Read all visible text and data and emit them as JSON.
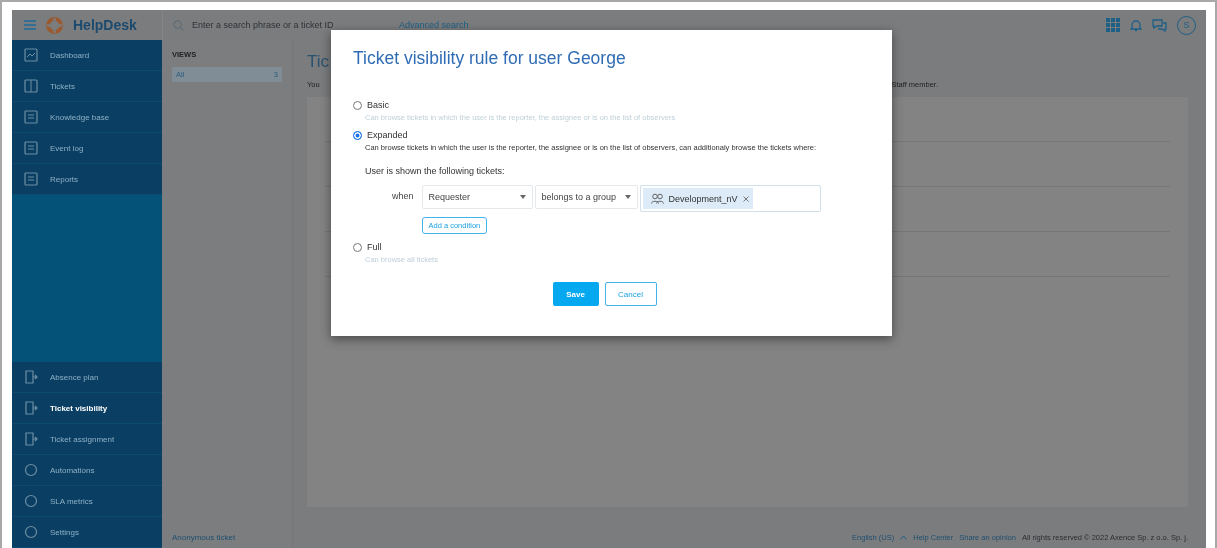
{
  "header": {
    "brand": "HelpDesk",
    "search": {
      "placeholder": "Enter a search phrase or a ticket ID"
    },
    "advanced_search": "Advanced search",
    "avatar": "S"
  },
  "sidebar": {
    "top_items": [
      {
        "label": "Dashboard",
        "selected": false
      },
      {
        "label": "Tickets",
        "selected": false
      },
      {
        "label": "Knowledge base",
        "selected": false
      },
      {
        "label": "Event log",
        "selected": false
      },
      {
        "label": "Reports",
        "selected": false
      }
    ],
    "bottom_items": [
      {
        "label": "Absence plan",
        "selected": false
      },
      {
        "label": "Ticket visibility",
        "selected": true
      },
      {
        "label": "Ticket assignment",
        "selected": false
      },
      {
        "label": "Automations",
        "selected": false
      },
      {
        "label": "SLA metrics",
        "selected": false
      },
      {
        "label": "Settings",
        "selected": false
      }
    ]
  },
  "views": {
    "heading": "VIEWS",
    "items": [
      {
        "label": "All",
        "count": "3",
        "selected": true
      }
    ],
    "footer_link": "Anonymous ticket"
  },
  "content": {
    "title": "Tic",
    "intro_start": "You",
    "intro_end": "Staff member."
  },
  "footer": {
    "language": "English (US)",
    "links": [
      "Help Center",
      "Share an opinion"
    ],
    "copyright": "All rights reserved © 2022 Axence Sp. z o.o. Sp. j."
  },
  "dialog": {
    "title": "Ticket visibility rule for user George",
    "options": [
      {
        "label": "Basic",
        "description": "Can browse tickets in which the user is the reporter, the assignee or is on the list of observers",
        "selected": false
      },
      {
        "label": "Expanded",
        "description": "Can browse tickets in which the user is the reporter, the assignee or is on the list of observers, can additionaly browse the tickets where:",
        "selected": true,
        "rule": {
          "heading": "User is shown the following tickets:",
          "when": "when",
          "field": "Requester",
          "operator": "belongs to a group",
          "tags": [
            {
              "label": "Development_nV"
            }
          ],
          "add_button": "Add a condition"
        }
      },
      {
        "label": "Full",
        "description": "Can browse all tickets",
        "selected": false
      }
    ],
    "buttons": [
      {
        "label": "Save",
        "kind": "primary"
      },
      {
        "label": "Cancel",
        "kind": "secondary"
      }
    ]
  }
}
